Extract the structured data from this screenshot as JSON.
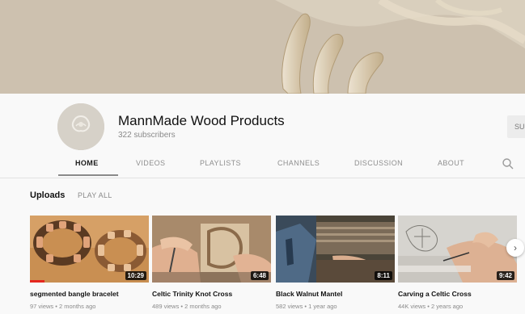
{
  "channel": {
    "name": "MannMade Wood Products",
    "subscribers": "322 subscribers",
    "subscribe_label": "SU"
  },
  "tabs": [
    {
      "label": "HOME",
      "active": true
    },
    {
      "label": "VIDEOS",
      "active": false
    },
    {
      "label": "PLAYLISTS",
      "active": false
    },
    {
      "label": "CHANNELS",
      "active": false
    },
    {
      "label": "DISCUSSION",
      "active": false
    },
    {
      "label": "ABOUT",
      "active": false
    }
  ],
  "icons": {
    "search": "search-icon",
    "next": "chevron-right-icon"
  },
  "uploads": {
    "title": "Uploads",
    "play_all": "PLAY ALL",
    "videos": [
      {
        "title": "segmented bangle bracelet",
        "meta": "97 views • 2 months ago",
        "duration": "10:29",
        "watched_fraction": 0.12
      },
      {
        "title": "Celtic Trinity Knot Cross",
        "meta": "489 views • 2 months ago",
        "duration": "6:48"
      },
      {
        "title": "Black Walnut Mantel",
        "meta": "582 views • 1 year ago",
        "duration": "8:11"
      },
      {
        "title": "Carving a Celtic Cross",
        "meta": "44K views • 2 years ago",
        "duration": "9:42"
      }
    ]
  },
  "colors": {
    "progress": "#e5271f",
    "page_bg": "#f9f9f9"
  }
}
